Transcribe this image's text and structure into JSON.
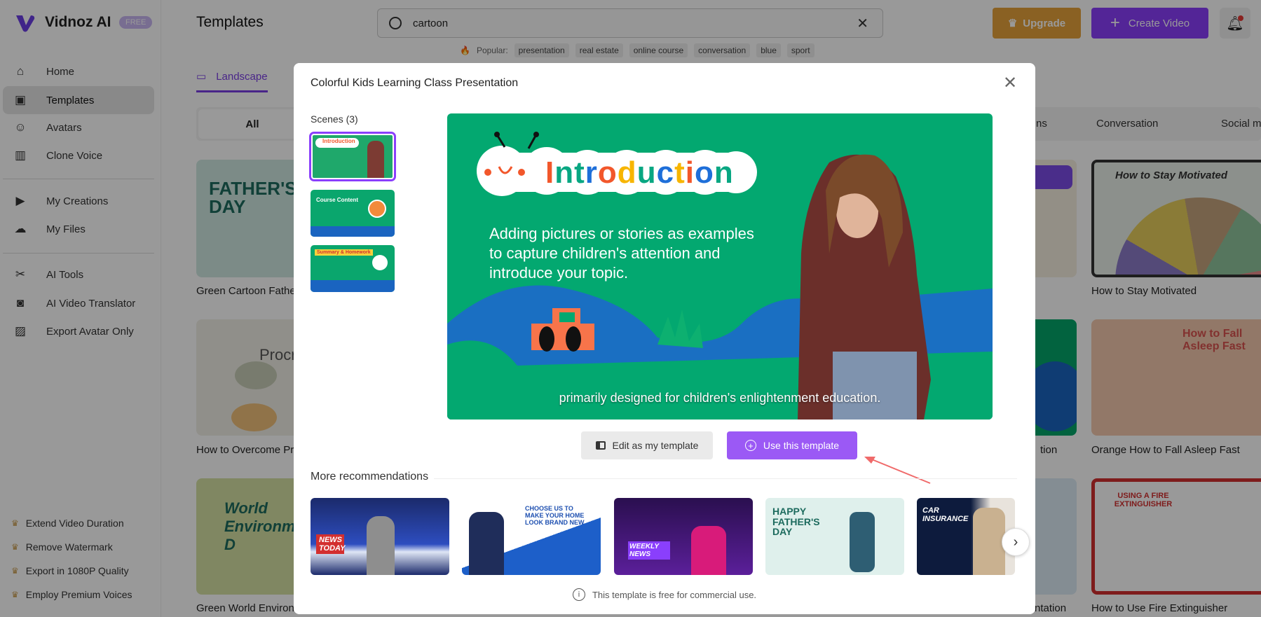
{
  "app": {
    "name": "Vidnoz AI",
    "badge": "FREE"
  },
  "sidebar": {
    "items": [
      {
        "label": "Home",
        "icon": "home-icon"
      },
      {
        "label": "Templates",
        "icon": "templates-icon",
        "active": true
      },
      {
        "label": "Avatars",
        "icon": "avatar-icon"
      },
      {
        "label": "Clone Voice",
        "icon": "voice-icon"
      },
      {
        "label": "My Creations",
        "icon": "creations-icon"
      },
      {
        "label": "My Files",
        "icon": "upload-cloud-icon"
      },
      {
        "label": "AI Tools",
        "icon": "tools-icon"
      },
      {
        "label": "AI Video Translator",
        "icon": "translator-icon"
      },
      {
        "label": "Export Avatar Only",
        "icon": "export-avatar-icon"
      }
    ],
    "perks": [
      "Extend Video Duration",
      "Remove Watermark",
      "Export in 1080P Quality",
      "Employ Premium Voices"
    ]
  },
  "header": {
    "title": "Templates",
    "search_value": "cartoon",
    "popular_label": "Popular:",
    "popular_tags": [
      "presentation",
      "real estate",
      "online course",
      "conversation",
      "blue",
      "sport"
    ],
    "upgrade_label": "Upgrade",
    "create_label": "Create Video"
  },
  "tabs": {
    "landscape": "Landscape"
  },
  "categories": {
    "all": "All",
    "partial": "ns",
    "conversation": "Conversation",
    "social": "Social me"
  },
  "background_cards": {
    "left": [
      "Green Cartoon Father's",
      "How to Overcome Proc",
      "Green World Environm"
    ],
    "left_thumbs": [
      "FATHER'S DAY",
      "Procra",
      "World Environment D"
    ],
    "mid": [
      "",
      "tion",
      "ntation"
    ],
    "right": [
      "How to Stay Motivated",
      "Orange How to Fall Asleep Fast",
      "How to Use Fire Extinguisher"
    ],
    "right_thumbs": [
      "How to Stay Motivated",
      "How to Fall Asleep Fast",
      "USING A FIRE EXTINGUISHER"
    ]
  },
  "modal": {
    "title": "Colorful Kids Learning Class Presentation",
    "scenes_label": "Scenes (3)",
    "scenes": [
      "Introduction",
      "Course Content",
      "Summary & Homework"
    ],
    "preview": {
      "heading": "Introduction",
      "heading_colors": [
        "#f2572b",
        "#08a782",
        "#08a782",
        "#1e6fd9",
        "#f2572b",
        "#f7b500",
        "#08a782",
        "#1e6fd9",
        "#f7b500",
        "#f2572b",
        "#1e6fd9",
        "#08a782"
      ],
      "body_lines": [
        "Adding pictures or stories as examples",
        "to capture children's attention and",
        "introduce your topic."
      ],
      "subtitle": "primarily designed for children's enlightenment education."
    },
    "edit_label": "Edit as my template",
    "use_label": "Use this template",
    "more_label": "More recommendations",
    "recommendations": [
      "NEWS TODAY",
      "CHOOSE US TO MAKE YOUR HOME LOOK BRAND NEW",
      "WEEKLY NEWS",
      "HAPPY FATHER'S DAY",
      "CAR INSURANCE"
    ],
    "footer_note": "This template is free for commercial use."
  },
  "colors": {
    "accent": "#8a3ffc",
    "use_button": "#9b59f5",
    "upgrade": "#e7a23b",
    "preview_green": "#03a870",
    "arrow": "#f06a6a"
  }
}
